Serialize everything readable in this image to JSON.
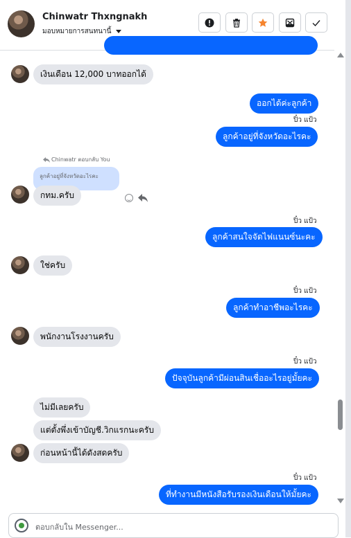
{
  "header": {
    "name": "Chinwatr Thxngnakh",
    "assign_label": "มอบหมายการสนทนานี้"
  },
  "toolbar": {
    "report_icon": "exclamation-circle-icon",
    "delete_icon": "trash-icon",
    "star_icon": "star-icon",
    "archive_icon": "inbox-icon",
    "done_icon": "check-icon",
    "star_color": "#f5842e"
  },
  "messages": {
    "m1": "เงินเดือน 12,000 บาทออกได้",
    "m2": "ออกได้ค่ะลูกค้า",
    "s1": "ปิ๋ว แป้ว",
    "m3": "ลูกค้าอยู่ที่จังหวัดอะไรคะ",
    "reply_header": "Chinwatr ตอบกลับ You",
    "reply_quote": "ลูกค้าอยู่ที่จังหวัดอะไรคะ",
    "m4": "กทม.ครับ",
    "s2": "ปิ๋ว แป้ว",
    "m5": "ลูกค้าสนใจจัดไฟแนนซ์นะคะ",
    "m6": "ใช่ครับ",
    "s3": "ปิ๋ว แป้ว",
    "m7": "ลูกค้าทำอาชีพอะไรคะ",
    "m8": "พนักงานโรงงานครับ",
    "s4": "ปิ๋ว แป้ว",
    "m9": "ปัจจุบันลูกค้ามีผ่อนสินเชื่ออะไรอยู่มั้ยคะ",
    "m10": "ไม่มีเลยครับ",
    "m11": "แต่ตั้งพึ่งเข้าบัญชี.วิกแรกนะครับ",
    "m12": "ก่อนหน้านี้ได้ดังสดครับ",
    "s5": "ปิ๋ว แป้ว",
    "m13": "ที่ทำงานมีหนังสือรับรองเงินเดือนให้มั้ยคะ"
  },
  "composer": {
    "placeholder": "ตอบกลับใน Messenger..."
  },
  "colors": {
    "outgoing": "#0866ff",
    "incoming": "#e4e6eb"
  }
}
